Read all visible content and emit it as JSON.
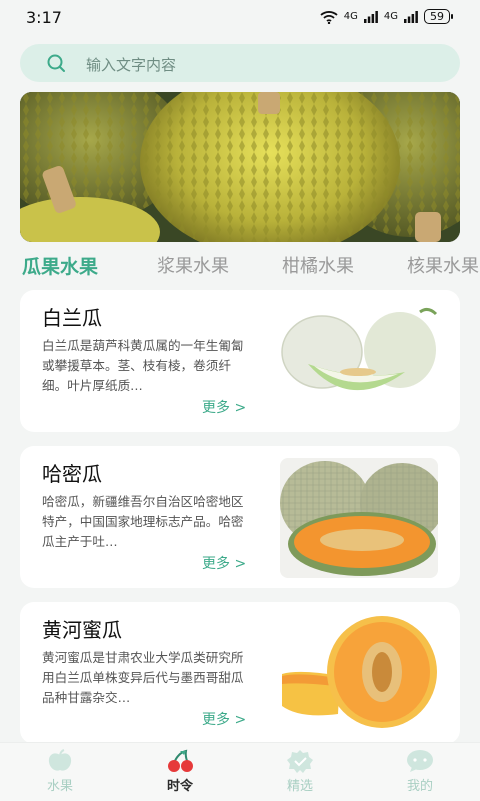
{
  "status_bar": {
    "time": "3:17",
    "signal_1": "4G",
    "signal_2": "4G",
    "battery": "59"
  },
  "search": {
    "placeholder": "输入文字内容"
  },
  "tabs": [
    {
      "label": "瓜果水果",
      "active": true
    },
    {
      "label": "浆果水果",
      "active": false
    },
    {
      "label": "柑橘水果",
      "active": false
    },
    {
      "label": "核果水果",
      "active": false
    }
  ],
  "cards": [
    {
      "title": "白兰瓜",
      "description": "白兰瓜是葫芦科黄瓜属的一年生匍匐或攀援草本。茎、枝有棱，卷须纤细。叶片厚纸质…",
      "more": "更多"
    },
    {
      "title": "哈密瓜",
      "description": "哈密瓜，新疆维吾尔自治区哈密地区特产，中国国家地理标志产品。哈密瓜主产于吐…",
      "more": "更多"
    },
    {
      "title": "黄河蜜瓜",
      "description": "黄河蜜瓜是甘肃农业大学瓜类研究所用白兰瓜单株变异后代与墨西哥甜瓜品种甘露杂交…",
      "more": "更多"
    }
  ],
  "bottom_nav": [
    {
      "label": "水果",
      "icon": "apple-icon",
      "active": false
    },
    {
      "label": "时令",
      "icon": "cherries-icon",
      "active": true
    },
    {
      "label": "精选",
      "icon": "badge-check-icon",
      "active": false
    },
    {
      "label": "我的",
      "icon": "chat-bubble-icon",
      "active": false
    }
  ],
  "colors": {
    "accent": "#3daa8a",
    "search_bg": "#dcefe8",
    "background": "#f3f5f4"
  }
}
